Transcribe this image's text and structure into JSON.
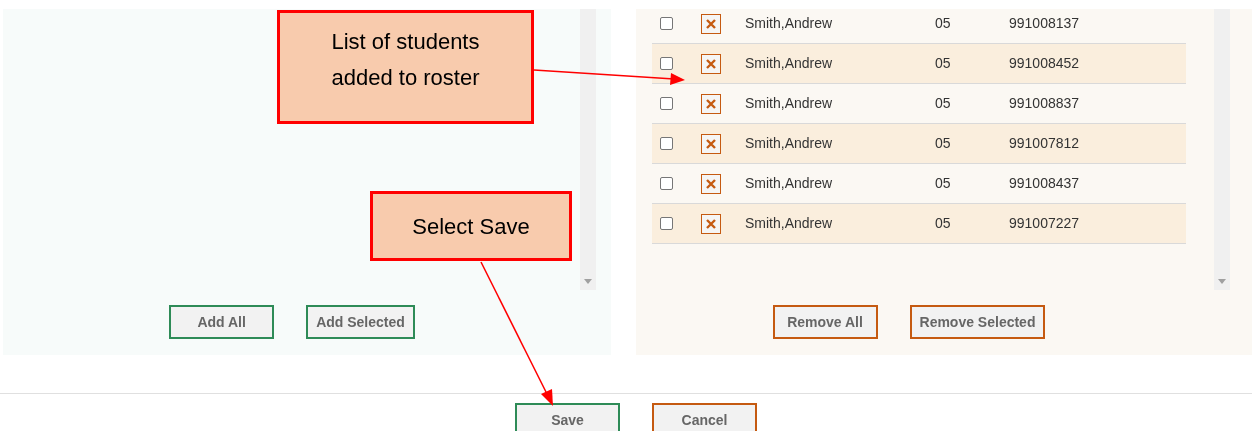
{
  "available_panel": {
    "buttons": [
      "Add All",
      "Add Selected"
    ]
  },
  "roster_panel": {
    "rows": [
      {
        "checked": false,
        "name": "Smith,Andrew",
        "section": "05",
        "id": "991008137"
      },
      {
        "checked": false,
        "name": "Smith,Andrew",
        "section": "05",
        "id": "991008452"
      },
      {
        "checked": false,
        "name": "Smith,Andrew",
        "section": "05",
        "id": "991008837"
      },
      {
        "checked": false,
        "name": "Smith,Andrew",
        "section": "05",
        "id": "991007812"
      },
      {
        "checked": false,
        "name": "Smith,Andrew",
        "section": "05",
        "id": "991008437"
      },
      {
        "checked": false,
        "name": "Smith,Andrew",
        "section": "05",
        "id": "991007227"
      }
    ],
    "buttons": [
      "Remove All",
      "Remove Selected"
    ]
  },
  "footer": {
    "buttons": [
      {
        "label": "Save",
        "kind": "primary"
      },
      {
        "label": "Cancel",
        "kind": "secondary"
      }
    ]
  },
  "callouts": [
    "List of students\nadded to roster",
    "Select Save"
  ]
}
